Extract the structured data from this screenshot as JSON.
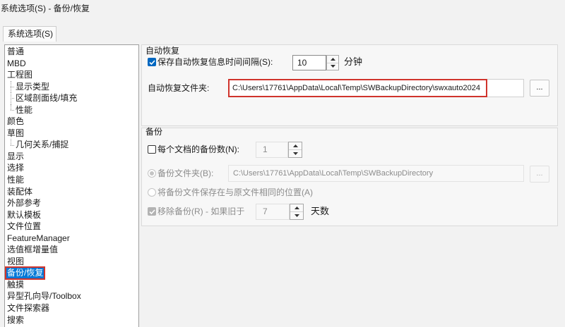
{
  "window": {
    "title": "系统选项(S) - 备份/恢复"
  },
  "tabs": [
    {
      "label": "系统选项(S)",
      "active": true
    }
  ],
  "sidebar": {
    "items": [
      {
        "label": "普通"
      },
      {
        "label": "MBD"
      },
      {
        "label": "工程图",
        "children": [
          {
            "label": "显示类型"
          },
          {
            "label": "区域剖面线/填充"
          },
          {
            "label": "性能"
          }
        ]
      },
      {
        "label": "颜色"
      },
      {
        "label": "草图",
        "children": [
          {
            "label": "几何关系/捕捉"
          }
        ]
      },
      {
        "label": "显示"
      },
      {
        "label": "选择"
      },
      {
        "label": "性能"
      },
      {
        "label": "装配体"
      },
      {
        "label": "外部参考"
      },
      {
        "label": "默认模板"
      },
      {
        "label": "文件位置"
      },
      {
        "label": "FeatureManager"
      },
      {
        "label": "选值框增量值"
      },
      {
        "label": "视图"
      },
      {
        "label": "备份/恢复",
        "selected": true
      },
      {
        "label": "触摸"
      },
      {
        "label": "异型孔向导/Toolbox"
      },
      {
        "label": "文件探索器"
      },
      {
        "label": "搜索"
      }
    ]
  },
  "auto_recover": {
    "group_label": "自动恢复",
    "save_interval": {
      "label": "保存自动恢复信息时间间隔(S):",
      "checked": true,
      "disabled": false,
      "value": "10",
      "unit": "分钟"
    },
    "folder": {
      "label": "自动恢复文件夹:",
      "value": "C:\\Users\\17761\\AppData\\Local\\Temp\\SWBackupDirectory\\swxauto2024",
      "browse_label": "..."
    }
  },
  "backup": {
    "group_label": "备份",
    "copies_per_document": {
      "label": "每个文档的备份数(N):",
      "checked": false,
      "disabled": false,
      "value": "1",
      "value_disabled": true
    },
    "backup_folder": {
      "label": "备份文件夹(B):",
      "selected": true,
      "disabled": true,
      "value": "C:\\Users\\17761\\AppData\\Local\\Temp\\SWBackupDirectory",
      "browse_label": "..."
    },
    "same_location": {
      "label": "将备份文件保存在与原文件相同的位置(A)",
      "selected": false,
      "disabled": true
    },
    "remove_backups": {
      "label": "移除备份(R) - 如果旧于",
      "checked": true,
      "disabled": true,
      "value": "7",
      "unit": "天数"
    }
  },
  "icons": {
    "check": "checkmark-icon",
    "spin_up": "triangle-up-icon",
    "spin_down": "triangle-down-icon"
  },
  "colors": {
    "accent": "#0067c0",
    "selection": "#0078d7",
    "highlight_frame": "#d0342c",
    "disabled_text": "#8c8c8c"
  }
}
